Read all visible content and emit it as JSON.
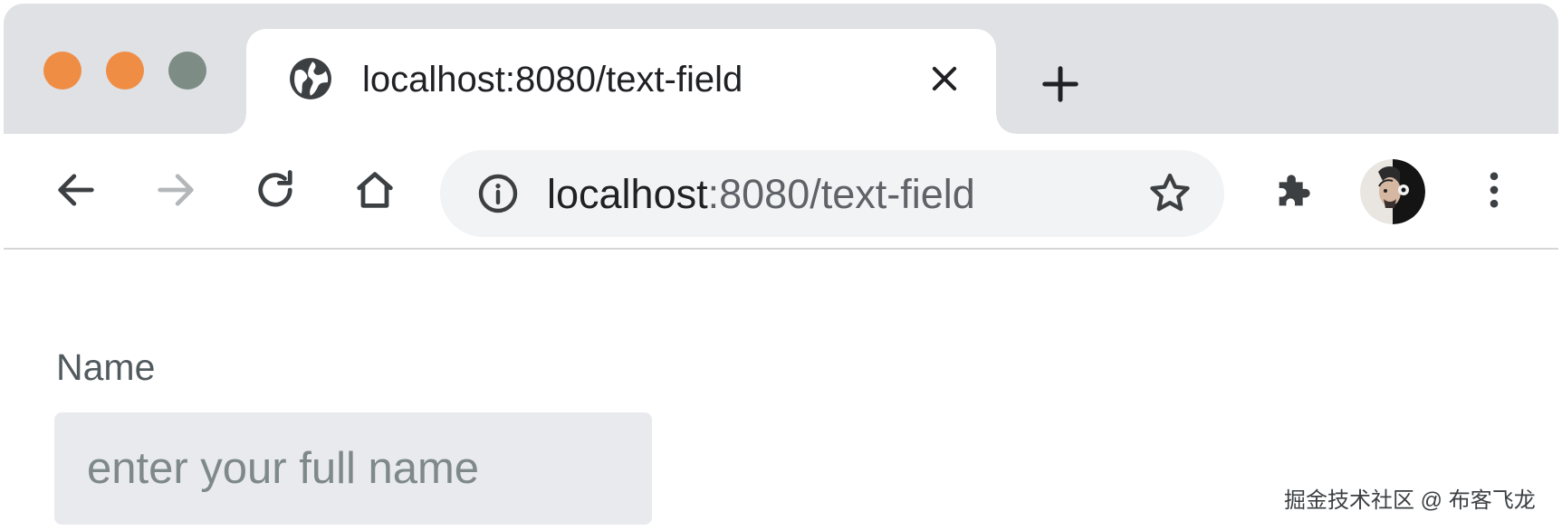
{
  "colors": {
    "traffic_close": "#f08d45",
    "traffic_minimize": "#f08d45",
    "traffic_zoom": "#7d8c84",
    "tab_strip": "#dfe1e5",
    "input_background": "#e8eaed"
  },
  "window": {
    "traffic_lights": [
      "close",
      "minimize",
      "zoom"
    ]
  },
  "tab": {
    "title": "localhost:8080/text-field",
    "favicon": "globe-icon",
    "close_icon": "close-icon"
  },
  "new_tab": {
    "icon": "plus-icon"
  },
  "toolbar": {
    "back_icon": "arrow-left-icon",
    "forward_icon": "arrow-right-icon",
    "forward_enabled": false,
    "reload_icon": "reload-icon",
    "home_icon": "home-icon",
    "site_info_icon": "info-icon",
    "url_host": "localhost",
    "url_rest": ":8080/text-field",
    "bookmark_icon": "star-icon",
    "extensions_icon": "puzzle-icon",
    "profile_icon": "avatar",
    "menu_icon": "kebab-menu-icon"
  },
  "form": {
    "name_label": "Name",
    "name_value": "",
    "name_placeholder": "enter your full name"
  },
  "watermark": "掘金技术社区 @ 布客飞龙"
}
